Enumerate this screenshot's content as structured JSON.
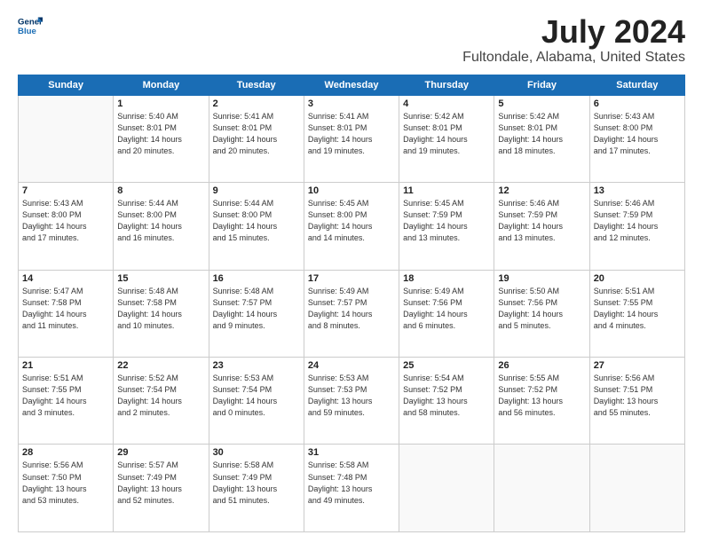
{
  "header": {
    "logo_line1": "General",
    "logo_line2": "Blue",
    "title": "July 2024",
    "subtitle": "Fultondale, Alabama, United States"
  },
  "days_of_week": [
    "Sunday",
    "Monday",
    "Tuesday",
    "Wednesday",
    "Thursday",
    "Friday",
    "Saturday"
  ],
  "weeks": [
    [
      {
        "day": "",
        "info": ""
      },
      {
        "day": "1",
        "info": "Sunrise: 5:40 AM\nSunset: 8:01 PM\nDaylight: 14 hours\nand 20 minutes."
      },
      {
        "day": "2",
        "info": "Sunrise: 5:41 AM\nSunset: 8:01 PM\nDaylight: 14 hours\nand 20 minutes."
      },
      {
        "day": "3",
        "info": "Sunrise: 5:41 AM\nSunset: 8:01 PM\nDaylight: 14 hours\nand 19 minutes."
      },
      {
        "day": "4",
        "info": "Sunrise: 5:42 AM\nSunset: 8:01 PM\nDaylight: 14 hours\nand 19 minutes."
      },
      {
        "day": "5",
        "info": "Sunrise: 5:42 AM\nSunset: 8:01 PM\nDaylight: 14 hours\nand 18 minutes."
      },
      {
        "day": "6",
        "info": "Sunrise: 5:43 AM\nSunset: 8:00 PM\nDaylight: 14 hours\nand 17 minutes."
      }
    ],
    [
      {
        "day": "7",
        "info": "Sunrise: 5:43 AM\nSunset: 8:00 PM\nDaylight: 14 hours\nand 17 minutes."
      },
      {
        "day": "8",
        "info": "Sunrise: 5:44 AM\nSunset: 8:00 PM\nDaylight: 14 hours\nand 16 minutes."
      },
      {
        "day": "9",
        "info": "Sunrise: 5:44 AM\nSunset: 8:00 PM\nDaylight: 14 hours\nand 15 minutes."
      },
      {
        "day": "10",
        "info": "Sunrise: 5:45 AM\nSunset: 8:00 PM\nDaylight: 14 hours\nand 14 minutes."
      },
      {
        "day": "11",
        "info": "Sunrise: 5:45 AM\nSunset: 7:59 PM\nDaylight: 14 hours\nand 13 minutes."
      },
      {
        "day": "12",
        "info": "Sunrise: 5:46 AM\nSunset: 7:59 PM\nDaylight: 14 hours\nand 13 minutes."
      },
      {
        "day": "13",
        "info": "Sunrise: 5:46 AM\nSunset: 7:59 PM\nDaylight: 14 hours\nand 12 minutes."
      }
    ],
    [
      {
        "day": "14",
        "info": "Sunrise: 5:47 AM\nSunset: 7:58 PM\nDaylight: 14 hours\nand 11 minutes."
      },
      {
        "day": "15",
        "info": "Sunrise: 5:48 AM\nSunset: 7:58 PM\nDaylight: 14 hours\nand 10 minutes."
      },
      {
        "day": "16",
        "info": "Sunrise: 5:48 AM\nSunset: 7:57 PM\nDaylight: 14 hours\nand 9 minutes."
      },
      {
        "day": "17",
        "info": "Sunrise: 5:49 AM\nSunset: 7:57 PM\nDaylight: 14 hours\nand 8 minutes."
      },
      {
        "day": "18",
        "info": "Sunrise: 5:49 AM\nSunset: 7:56 PM\nDaylight: 14 hours\nand 6 minutes."
      },
      {
        "day": "19",
        "info": "Sunrise: 5:50 AM\nSunset: 7:56 PM\nDaylight: 14 hours\nand 5 minutes."
      },
      {
        "day": "20",
        "info": "Sunrise: 5:51 AM\nSunset: 7:55 PM\nDaylight: 14 hours\nand 4 minutes."
      }
    ],
    [
      {
        "day": "21",
        "info": "Sunrise: 5:51 AM\nSunset: 7:55 PM\nDaylight: 14 hours\nand 3 minutes."
      },
      {
        "day": "22",
        "info": "Sunrise: 5:52 AM\nSunset: 7:54 PM\nDaylight: 14 hours\nand 2 minutes."
      },
      {
        "day": "23",
        "info": "Sunrise: 5:53 AM\nSunset: 7:54 PM\nDaylight: 14 hours\nand 0 minutes."
      },
      {
        "day": "24",
        "info": "Sunrise: 5:53 AM\nSunset: 7:53 PM\nDaylight: 13 hours\nand 59 minutes."
      },
      {
        "day": "25",
        "info": "Sunrise: 5:54 AM\nSunset: 7:52 PM\nDaylight: 13 hours\nand 58 minutes."
      },
      {
        "day": "26",
        "info": "Sunrise: 5:55 AM\nSunset: 7:52 PM\nDaylight: 13 hours\nand 56 minutes."
      },
      {
        "day": "27",
        "info": "Sunrise: 5:56 AM\nSunset: 7:51 PM\nDaylight: 13 hours\nand 55 minutes."
      }
    ],
    [
      {
        "day": "28",
        "info": "Sunrise: 5:56 AM\nSunset: 7:50 PM\nDaylight: 13 hours\nand 53 minutes."
      },
      {
        "day": "29",
        "info": "Sunrise: 5:57 AM\nSunset: 7:49 PM\nDaylight: 13 hours\nand 52 minutes."
      },
      {
        "day": "30",
        "info": "Sunrise: 5:58 AM\nSunset: 7:49 PM\nDaylight: 13 hours\nand 51 minutes."
      },
      {
        "day": "31",
        "info": "Sunrise: 5:58 AM\nSunset: 7:48 PM\nDaylight: 13 hours\nand 49 minutes."
      },
      {
        "day": "",
        "info": ""
      },
      {
        "day": "",
        "info": ""
      },
      {
        "day": "",
        "info": ""
      }
    ]
  ]
}
